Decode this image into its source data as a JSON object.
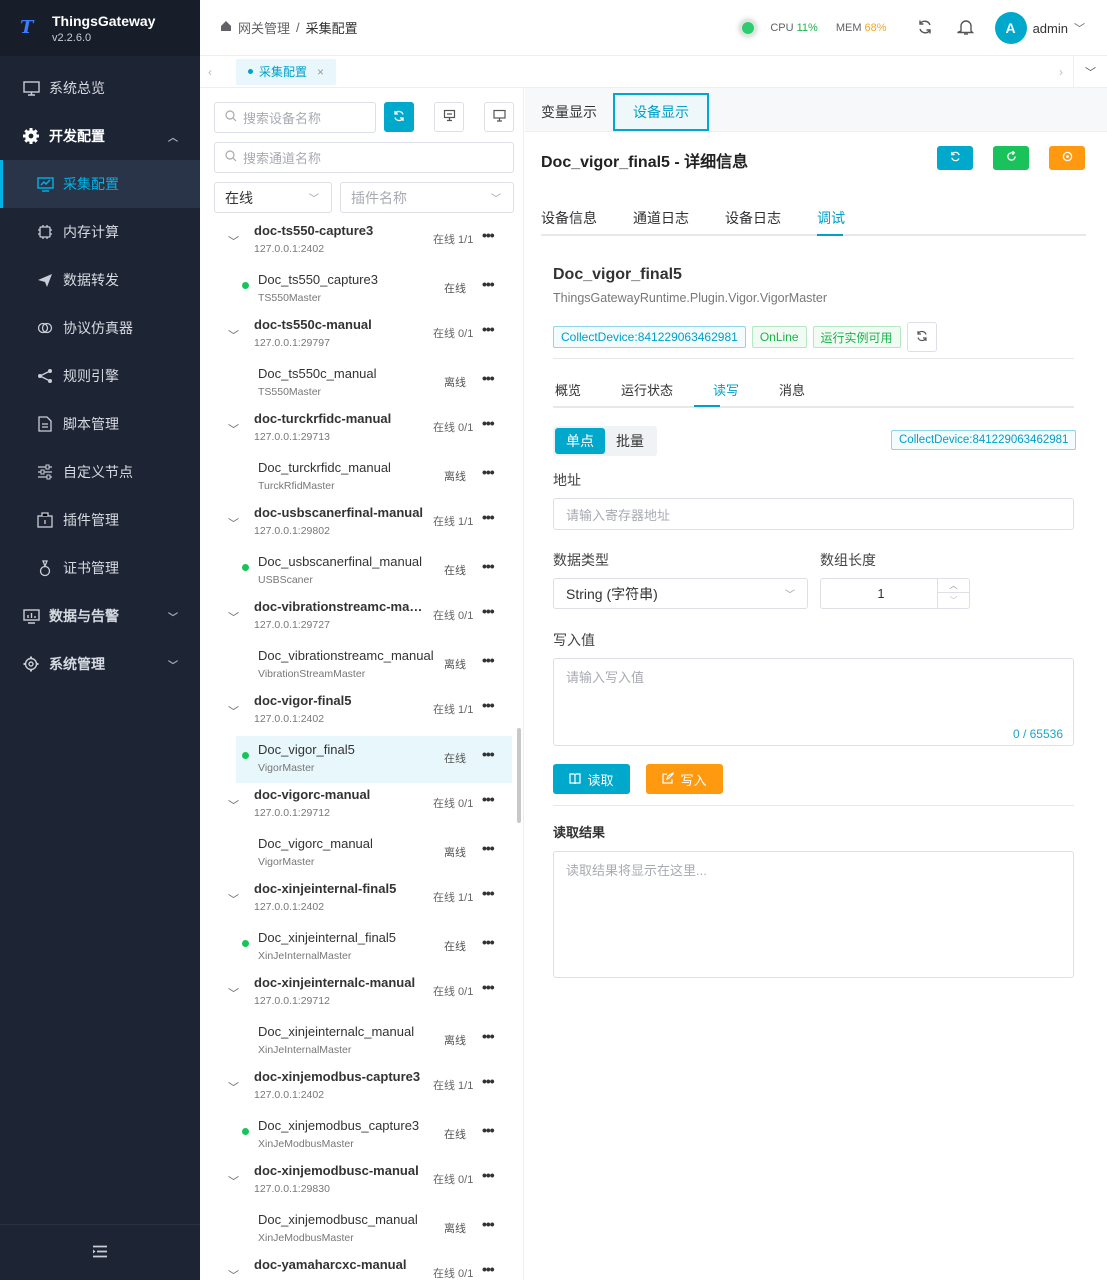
{
  "app": {
    "name": "ThingsGateway",
    "version": "v2.2.6.0"
  },
  "sidebar": {
    "items": [
      {
        "label": "系统总览",
        "icon": "monitor-icon"
      },
      {
        "label": "开发配置",
        "icon": "gear-icon"
      },
      {
        "label": "采集配置",
        "icon": "chart-screen-icon"
      },
      {
        "label": "内存计算",
        "icon": "chip-icon"
      },
      {
        "label": "数据转发",
        "icon": "send-icon"
      },
      {
        "label": "协议仿真器",
        "icon": "link-icon"
      },
      {
        "label": "规则引擎",
        "icon": "share-icon"
      },
      {
        "label": "脚本管理",
        "icon": "document-icon"
      },
      {
        "label": "自定义节点",
        "icon": "sliders-icon"
      },
      {
        "label": "插件管理",
        "icon": "package-icon"
      },
      {
        "label": "证书管理",
        "icon": "certificate-icon"
      },
      {
        "label": "数据与告警",
        "icon": "chart-icon"
      },
      {
        "label": "系统管理",
        "icon": "gear-icon"
      }
    ]
  },
  "header": {
    "breadcrumb": [
      "网关管理",
      "采集配置"
    ],
    "cpu_label": "CPU",
    "cpu": "11%",
    "mem_label": "MEM",
    "mem": "68%",
    "user": "admin",
    "avatar": "A",
    "colors": {
      "cpu": "#19b34c",
      "mem": "#f5a623"
    }
  },
  "tabs": {
    "open": "采集配置"
  },
  "filters": {
    "device_placeholder": "搜索设备名称",
    "channel_placeholder": "搜索通道名称",
    "status": "在线",
    "plugin_placeholder": "插件名称"
  },
  "tree": [
    {
      "name": "doc-ts550-capture3",
      "ip": "127.0.0.1:2402",
      "status": "在线 1/1",
      "device": {
        "name": "Doc_ts550_capture3",
        "plugin": "TS550Master",
        "status": "在线",
        "online": true
      }
    },
    {
      "name": "doc-ts550c-manual",
      "ip": "127.0.0.1:29797",
      "status": "在线 0/1",
      "device": {
        "name": "Doc_ts550c_manual",
        "plugin": "TS550Master",
        "status": "离线",
        "online": false
      }
    },
    {
      "name": "doc-turckrfidc-manual",
      "ip": "127.0.0.1:29713",
      "status": "在线 0/1",
      "device": {
        "name": "Doc_turckrfidc_manual",
        "plugin": "TurckRfidMaster",
        "status": "离线",
        "online": false
      }
    },
    {
      "name": "doc-usbscanerfinal-manual",
      "ip": "127.0.0.1:29802",
      "status": "在线 1/1",
      "device": {
        "name": "Doc_usbscanerfinal_manual",
        "plugin": "USBScaner",
        "status": "在线",
        "online": true
      }
    },
    {
      "name": "doc-vibrationstreamc-man...",
      "ip": "127.0.0.1:29727",
      "status": "在线 0/1",
      "device": {
        "name": "Doc_vibrationstreamc_manual",
        "plugin": "VibrationStreamMaster",
        "status": "离线",
        "online": false
      }
    },
    {
      "name": "doc-vigor-final5",
      "ip": "127.0.0.1:2402",
      "status": "在线 1/1",
      "device": {
        "name": "Doc_vigor_final5",
        "plugin": "VigorMaster",
        "status": "在线",
        "online": true,
        "selected": true
      }
    },
    {
      "name": "doc-vigorc-manual",
      "ip": "127.0.0.1:29712",
      "status": "在线 0/1",
      "device": {
        "name": "Doc_vigorc_manual",
        "plugin": "VigorMaster",
        "status": "离线",
        "online": false
      }
    },
    {
      "name": "doc-xinjeinternal-final5",
      "ip": "127.0.0.1:2402",
      "status": "在线 1/1",
      "device": {
        "name": "Doc_xinjeinternal_final5",
        "plugin": "XinJeInternalMaster",
        "status": "在线",
        "online": true
      }
    },
    {
      "name": "doc-xinjeinternalc-manual",
      "ip": "127.0.0.1:29712",
      "status": "在线 0/1",
      "device": {
        "name": "Doc_xinjeinternalc_manual",
        "plugin": "XinJeInternalMaster",
        "status": "离线",
        "online": false
      }
    },
    {
      "name": "doc-xinjemodbus-capture3",
      "ip": "127.0.0.1:2402",
      "status": "在线 1/1",
      "device": {
        "name": "Doc_xinjemodbus_capture3",
        "plugin": "XinJeModbusMaster",
        "status": "在线",
        "online": true
      }
    },
    {
      "name": "doc-xinjemodbusc-manual",
      "ip": "127.0.0.1:29830",
      "status": "在线 0/1",
      "device": {
        "name": "Doc_xinjemodbusc_manual",
        "plugin": "XinJeModbusMaster",
        "status": "离线",
        "online": false
      }
    },
    {
      "name": "doc-yamaharcxc-manual",
      "ip": "",
      "status": "在线 0/1",
      "device": null
    }
  ],
  "detail": {
    "view_tabs": [
      "变量显示",
      "设备显示"
    ],
    "title": "Doc_vigor_final5 - 详细信息",
    "tabs": [
      "设备信息",
      "通道日志",
      "设备日志",
      "调试"
    ],
    "device_name": "Doc_vigor_final5",
    "plugin_path": "ThingsGatewayRuntime.Plugin.Vigor.VigorMaster",
    "tags": [
      "CollectDevice:841229063462981",
      "OnLine",
      "运行实例可用"
    ],
    "subtabs": [
      "概览",
      "运行状态",
      "读写",
      "消息"
    ],
    "mode": [
      "单点",
      "批量"
    ],
    "device_tag": "CollectDevice:841229063462981",
    "address_label": "地址",
    "address_placeholder": "请输入寄存器地址",
    "datatype_label": "数据类型",
    "datatype_value": "String (字符串)",
    "arraylen_label": "数组长度",
    "arraylen_value": "1",
    "write_label": "写入值",
    "write_placeholder": "请输入写入值",
    "counter": "0 / 65536",
    "read_btn": "读取",
    "write_btn": "写入",
    "result_label": "读取结果",
    "result_placeholder": "读取结果将显示在这里..."
  }
}
